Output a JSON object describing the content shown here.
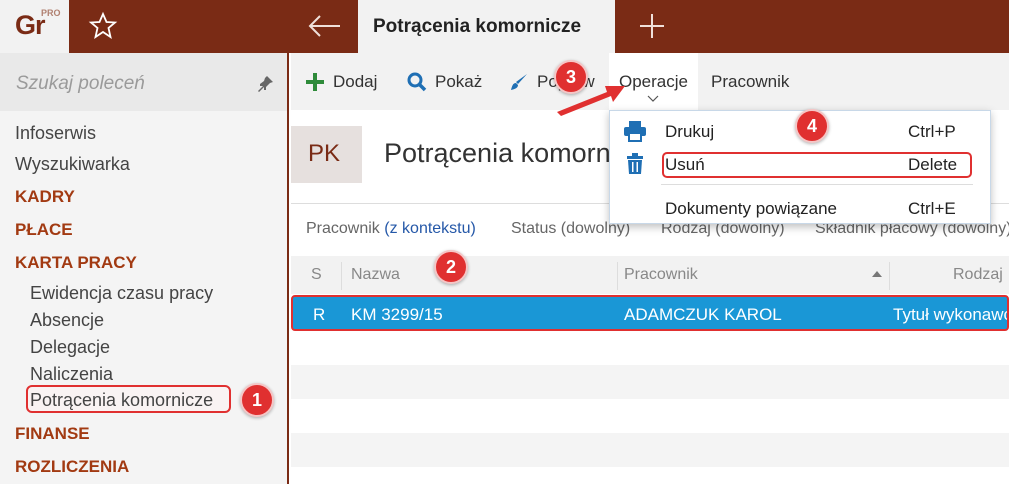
{
  "app": {
    "logo": "Gr",
    "logo_badge": "PRO"
  },
  "tabs": {
    "active": "Potrącenia komornicze"
  },
  "sidebar": {
    "search_placeholder": "Szukaj poleceń",
    "items": [
      {
        "label": "Infoserwis",
        "type": "item"
      },
      {
        "label": "Wyszukiwarka",
        "type": "item"
      },
      {
        "label": "KADRY",
        "type": "section"
      },
      {
        "label": "PŁACE",
        "type": "section"
      },
      {
        "label": "KARTA PRACY",
        "type": "section"
      },
      {
        "label": "Ewidencja czasu pracy",
        "type": "sub"
      },
      {
        "label": "Absencje",
        "type": "sub"
      },
      {
        "label": "Delegacje",
        "type": "sub"
      },
      {
        "label": "Naliczenia",
        "type": "sub"
      },
      {
        "label": "Potrącenia komornicze",
        "type": "sub",
        "active": true
      },
      {
        "label": "FINANSE",
        "type": "section"
      },
      {
        "label": "ROZLICZENIA",
        "type": "section"
      }
    ]
  },
  "toolbar": {
    "add": "Dodaj",
    "show": "Pokaż",
    "edit": "Popraw",
    "operations": "Operacje",
    "employee": "Pracownik"
  },
  "header": {
    "badge": "PK",
    "title": "Potrącenia komornicze"
  },
  "filters": {
    "employee_label": "Pracownik",
    "employee_value": "(z kontekstu)",
    "status": "Status (dowolny)",
    "kind": "Rodzaj (dowolny)",
    "component": "Składnik płacowy (dowolny)"
  },
  "table": {
    "columns": [
      "S",
      "Nazwa",
      "Pracownik",
      "Rodzaj"
    ],
    "rows": [
      {
        "s": "R",
        "name": "KM 3299/15",
        "employee": "ADAMCZUK KAROL",
        "kind": "Tytuł wykonawczy"
      }
    ]
  },
  "dropdown": {
    "items": [
      {
        "label": "Drukuj",
        "shortcut": "Ctrl+P",
        "icon": "printer-icon"
      },
      {
        "label": "Usuń",
        "shortcut": "Delete",
        "icon": "trash-icon"
      },
      {
        "label": "Dokumenty powiązane",
        "shortcut": "Ctrl+E",
        "icon": ""
      }
    ]
  },
  "callouts": [
    "1",
    "2",
    "3",
    "4"
  ],
  "colors": {
    "brand": "#7a2b15",
    "accent_red": "#e03030",
    "selection": "#1a97d6",
    "section": "#a23a12",
    "add_icon": "#2e8b3a",
    "show_icon": "#1f6fb4"
  }
}
